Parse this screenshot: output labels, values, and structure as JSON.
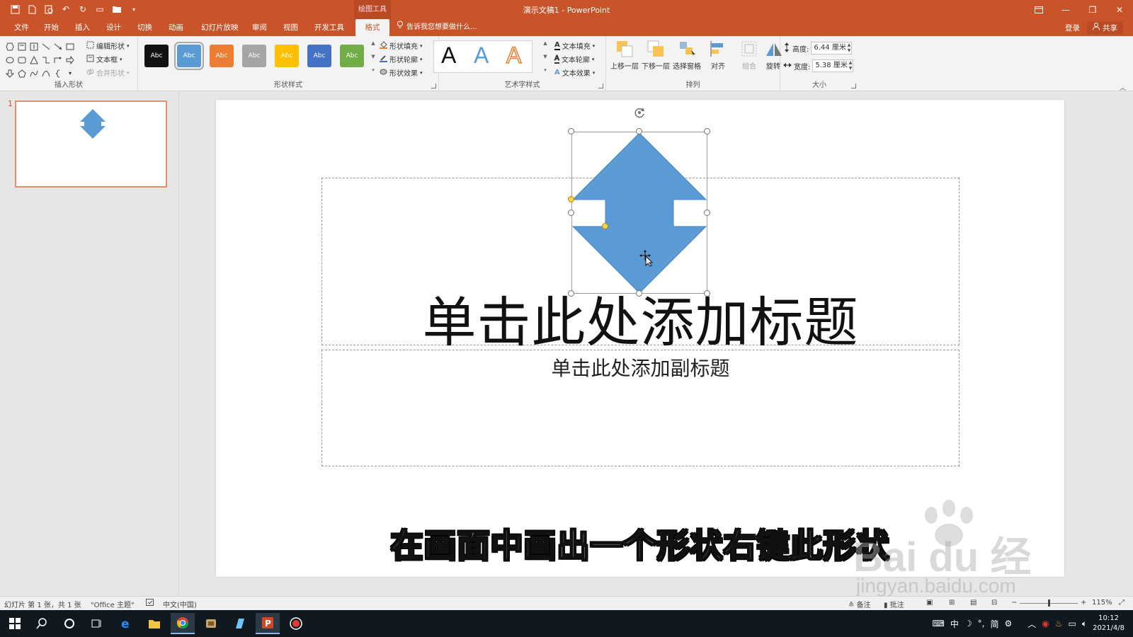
{
  "window": {
    "title": "演示文稿1 - PowerPoint",
    "context_tab": "绘图工具"
  },
  "tabs": [
    {
      "label": "文件"
    },
    {
      "label": "开始"
    },
    {
      "label": "插入"
    },
    {
      "label": "设计"
    },
    {
      "label": "切换"
    },
    {
      "label": "动画"
    },
    {
      "label": "幻灯片放映"
    },
    {
      "label": "审阅"
    },
    {
      "label": "视图"
    },
    {
      "label": "开发工具"
    },
    {
      "label": "格式",
      "active": true
    }
  ],
  "tell_me": "告诉我您想要做什么...",
  "account": {
    "login": "登录",
    "share": "共享"
  },
  "ribbon": {
    "insert_shapes": {
      "label": "插入形状",
      "edit_shape": "编辑形状",
      "text_box": "文本框",
      "merge_shapes": "合并形状"
    },
    "shape_styles": {
      "label": "形状样式",
      "thumbs": [
        {
          "text": "Abc",
          "color": "#111111"
        },
        {
          "text": "Abc",
          "color": "#5b9bd5",
          "selected": true
        },
        {
          "text": "Abc",
          "color": "#ed7d31"
        },
        {
          "text": "Abc",
          "color": "#a5a5a5"
        },
        {
          "text": "Abc",
          "color": "#ffc000"
        },
        {
          "text": "Abc",
          "color": "#4472c4"
        },
        {
          "text": "Abc",
          "color": "#70ad47"
        }
      ],
      "fill": "形状填充",
      "outline": "形状轮廓",
      "effects": "形状效果"
    },
    "wordart": {
      "label": "艺术字样式",
      "samples": [
        "A",
        "A",
        "A"
      ],
      "text_fill": "文本填充",
      "text_outline": "文本轮廓",
      "text_effects": "文本效果"
    },
    "arrange": {
      "label": "排列",
      "bring_forward": "上移一层",
      "send_backward": "下移一层",
      "selection_pane": "选择窗格",
      "align": "对齐",
      "group": "组合",
      "rotate": "旋转"
    },
    "size": {
      "label": "大小",
      "height_label": "高度:",
      "height_value": "6.44 厘米",
      "width_label": "宽度:",
      "width_value": "5.38 厘米"
    }
  },
  "thumbnails": [
    {
      "number": "1"
    }
  ],
  "slide": {
    "title_placeholder": "单击此处添加标题",
    "subtitle_placeholder": "单击此处添加副标题",
    "shape_color": "#5b9bd5"
  },
  "caption": "在画面中画出一个形状右键此形状",
  "watermark": {
    "brand": "Bai du 经验",
    "url": "jingyan.baidu.com"
  },
  "status": {
    "slide_info": "幻灯片 第 1 张，共 1 张",
    "theme": "\"Office 主题\"",
    "language": "中文(中国)",
    "notes": "备注",
    "comments": "批注",
    "zoom": "115%"
  },
  "taskbar": {
    "ime": [
      "中",
      "简"
    ],
    "time": "10:12",
    "date": "2021/4/8"
  }
}
